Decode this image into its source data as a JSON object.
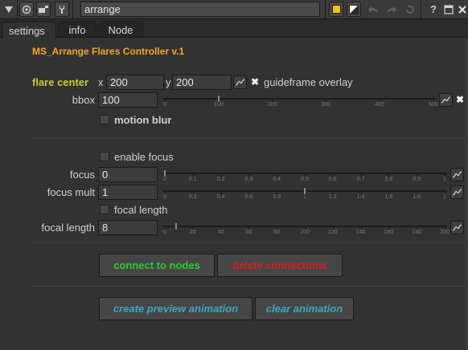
{
  "toolbar": {
    "node_name": "arrange",
    "help_label": "?",
    "colors": {
      "tile_color": "#f5c211",
      "accent": "#f5a623"
    }
  },
  "tabs": [
    "settings",
    "info",
    "Node"
  ],
  "panel": {
    "title": "MS_Arrange Flares Controller v.1",
    "flare_center": {
      "label": "flare center",
      "x_label": "x",
      "x_value": "200",
      "y_label": "y",
      "y_value": "200"
    },
    "guideframe_overlay": {
      "label": "guideframe overlay",
      "checked": true
    },
    "bbox": {
      "label": "bbox",
      "value": "100",
      "ticks": [
        "0",
        "100",
        "200",
        "300",
        "400",
        "500"
      ],
      "slider_value": 100,
      "range": [
        0,
        500
      ]
    },
    "motion_blur": {
      "label": "motion blur",
      "checked": false
    },
    "enable_focus": {
      "label": "enable focus",
      "checked": false
    },
    "focus": {
      "label": "focus",
      "value": "0",
      "ticks": [
        "0",
        "0.1",
        "0.2",
        "0.3",
        "0.4",
        "0.5",
        "0.6",
        "0.7",
        "0.8",
        "0.9",
        "1"
      ],
      "slider_value": 0,
      "range": [
        0,
        1
      ]
    },
    "focus_mult": {
      "label": "focus mult",
      "value": "1",
      "ticks": [
        "0",
        "0.2",
        "0.4",
        "0.6",
        "0.8",
        "1",
        "1.2",
        "1.4",
        "1.6",
        "1.8",
        "2"
      ],
      "slider_value": 1,
      "range": [
        0,
        2
      ]
    },
    "focal_length_toggle": {
      "label": "focal length",
      "checked": false
    },
    "focal_length": {
      "label": "focal length",
      "value": "8",
      "ticks": [
        "0",
        "20",
        "40",
        "60",
        "80",
        "100",
        "120",
        "140",
        "160",
        "180",
        "200"
      ],
      "slider_value": 8,
      "range": [
        0,
        200
      ]
    },
    "buttons": {
      "connect": "connect to nodes",
      "delete": "delete connections",
      "preview": "create preview animation",
      "clear": "clear animation"
    }
  }
}
